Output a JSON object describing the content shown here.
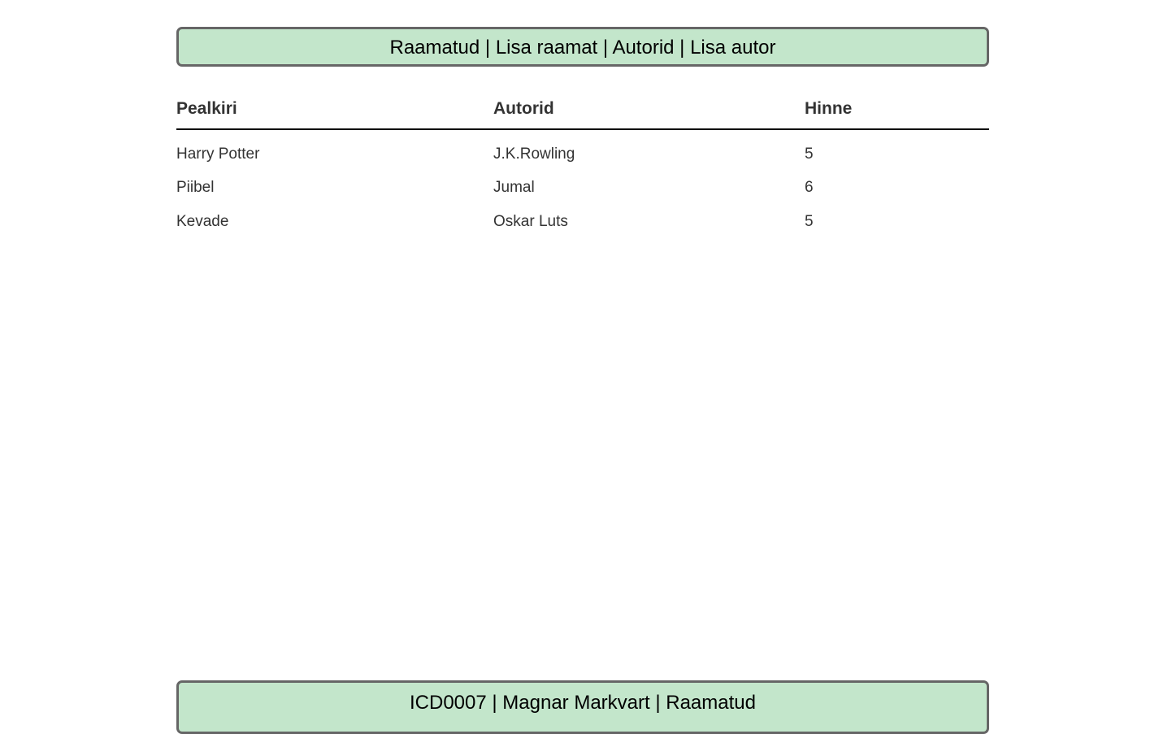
{
  "nav": {
    "items": [
      "Raamatud",
      "Lisa raamat",
      "Autorid",
      "Lisa autor"
    ],
    "separator": " | "
  },
  "table": {
    "headers": [
      "Pealkiri",
      "Autorid",
      "Hinne"
    ],
    "rows": [
      [
        "Harry Potter",
        "J.K.Rowling",
        "5"
      ],
      [
        "Piibel",
        "Jumal",
        "6"
      ],
      [
        "Kevade",
        "Oskar Luts",
        "5"
      ]
    ]
  },
  "footer": {
    "text": "ICD0007 | Magnar Markvart | Raamatud"
  }
}
